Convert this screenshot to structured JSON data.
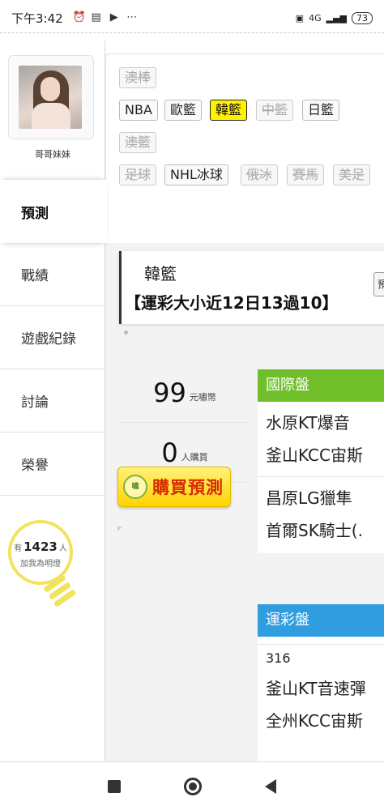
{
  "status_bar": {
    "time": "下午3:42",
    "network": "4G",
    "battery": "73"
  },
  "profile": {
    "name": "哥哥妹妹"
  },
  "sidebar": {
    "items": [
      {
        "label": "預測",
        "active": true
      },
      {
        "label": "戰績",
        "active": false
      },
      {
        "label": "遊戲紀錄",
        "active": false
      },
      {
        "label": "討論",
        "active": false
      },
      {
        "label": "榮譽",
        "active": false
      }
    ]
  },
  "bulb": {
    "prefix": "有",
    "count": "1423",
    "suffix": "人",
    "caption": "加我為明燈"
  },
  "filters": {
    "row1": [
      {
        "label": "澳棒",
        "state": "disabled"
      }
    ],
    "row2": [
      {
        "label": "NBA",
        "state": "normal"
      },
      {
        "label": "歐籃",
        "state": "normal"
      },
      {
        "label": "韓籃",
        "state": "selected"
      },
      {
        "label": "中籃",
        "state": "disabled"
      },
      {
        "label": "日籃",
        "state": "normal"
      }
    ],
    "row3": [
      {
        "label": "澳籃",
        "state": "disabled"
      }
    ],
    "row4": [
      {
        "label": "足球",
        "state": "disabled"
      },
      {
        "label": "NHL冰球",
        "state": "normal"
      },
      {
        "label": "俄冰",
        "state": "disabled"
      },
      {
        "label": "賽馬",
        "state": "disabled"
      },
      {
        "label": "美足",
        "state": "disabled"
      }
    ]
  },
  "prediction": {
    "league": "韓籃",
    "headline": "【運彩大小近12日13過10】",
    "side_button": "預",
    "coins_value": "99",
    "coins_unit": "元嘯幣",
    "buyers_value": "0",
    "buyers_unit": "人購買",
    "buy_button": "購買預測",
    "coin_badge": "嘯"
  },
  "international": {
    "header": "國際盤",
    "games": [
      {
        "home": "水原KT爆音",
        "away": "釜山KCC宙斯"
      },
      {
        "home": "昌原LG獵隼",
        "away": "首爾SK騎士(."
      }
    ]
  },
  "lottery": {
    "header": "運彩盤",
    "code": "316",
    "home": "釜山KT音速彈",
    "away": "全州KCC宙斯"
  },
  "colors": {
    "selected_tag": "#fff200",
    "intl_header": "#6fbe2a",
    "lottery_header": "#2f9de0",
    "buy_button": "#ffd200"
  }
}
